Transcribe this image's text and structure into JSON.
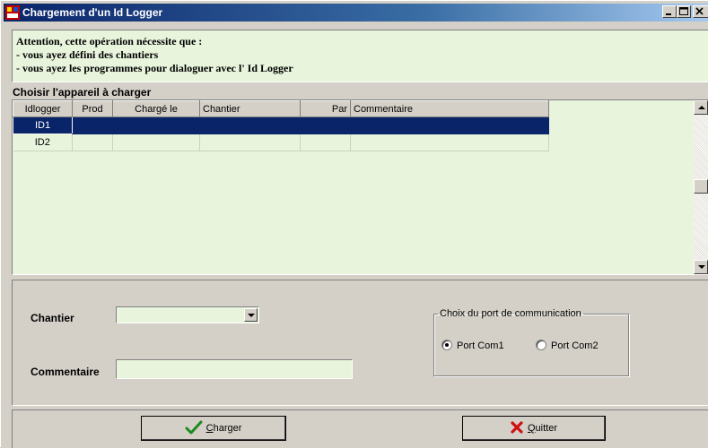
{
  "window": {
    "title": "Chargement d'un Id Logger",
    "controls": [
      "minimize-icon",
      "maximize-icon",
      "close-icon"
    ]
  },
  "warning": {
    "line1": "Attention, cette opération nécessite que :",
    "line2": "- vous ayez défini des chantiers",
    "line3": "- vous ayez les programmes pour dialoguer avec l' Id Logger"
  },
  "device_section": {
    "label": "Choisir l'appareil à charger"
  },
  "table": {
    "columns": [
      "Idlogger",
      "Prod",
      "Chargé le",
      "Chantier",
      "Par",
      "Commentaire"
    ],
    "rows": [
      {
        "idlogger": "ID1",
        "prod": "",
        "charge_le": "",
        "chantier": "",
        "par": "",
        "commentaire": "",
        "selected": true
      },
      {
        "idlogger": "ID2",
        "prod": "",
        "charge_le": "",
        "chantier": "",
        "par": "",
        "commentaire": "",
        "selected": false
      }
    ]
  },
  "form": {
    "chantier_label": "Chantier",
    "chantier_value": "",
    "commentaire_label": "Commentaire",
    "commentaire_value": ""
  },
  "port": {
    "legend": "Choix du port de communication",
    "options": [
      {
        "label": "Port Com1",
        "checked": true
      },
      {
        "label": "Port Com2",
        "checked": false
      }
    ]
  },
  "buttons": {
    "charger_first": "C",
    "charger_rest": "harger",
    "quitter_first": "Q",
    "quitter_rest": "uitter"
  },
  "colors": {
    "title_start": "#0a246a",
    "field_bg": "#e8f4dc",
    "selection": "#0a246a",
    "face": "#d4d0c8"
  }
}
